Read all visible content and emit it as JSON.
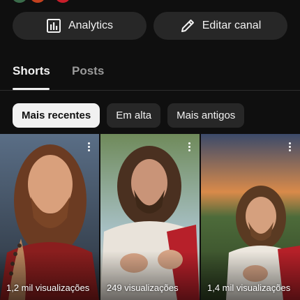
{
  "actions": {
    "analytics_label": "Analytics",
    "analytics_icon": "bar-chart-icon",
    "edit_label": "Editar canal",
    "edit_icon": "pencil-icon"
  },
  "tabs": [
    {
      "label": "Shorts",
      "active": true
    },
    {
      "label": "Posts",
      "active": false
    }
  ],
  "filters": [
    {
      "label": "Mais recentes",
      "selected": true
    },
    {
      "label": "Em alta",
      "selected": false
    },
    {
      "label": "Mais antigos",
      "selected": false
    }
  ],
  "shorts": [
    {
      "views": "1,2 mil visualizações",
      "menu_icon": "more-vert-icon"
    },
    {
      "views": "249 visualizações",
      "menu_icon": "more-vert-icon"
    },
    {
      "views": "1,4 mil visualizações",
      "menu_icon": "more-vert-icon"
    }
  ],
  "colors": {
    "background": "#0f0f0f",
    "button_bg": "#272727",
    "chip_selected_bg": "#f1f1f1",
    "text_primary": "#f1f1f1",
    "text_secondary": "#9a9a9a"
  }
}
